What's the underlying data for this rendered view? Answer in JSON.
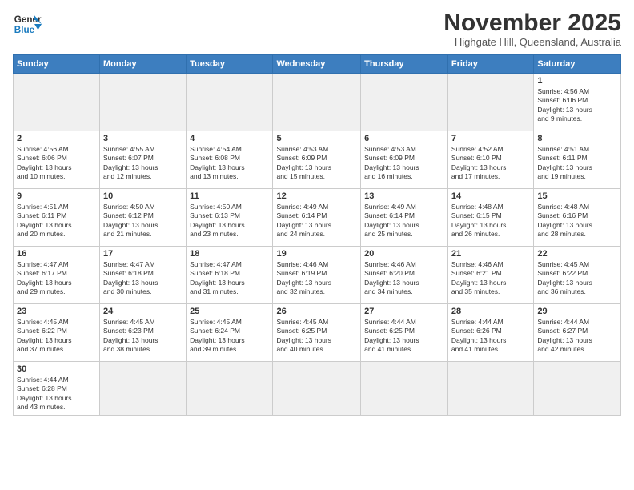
{
  "header": {
    "logo_line1": "General",
    "logo_line2": "Blue",
    "month": "November 2025",
    "location": "Highgate Hill, Queensland, Australia"
  },
  "weekdays": [
    "Sunday",
    "Monday",
    "Tuesday",
    "Wednesday",
    "Thursday",
    "Friday",
    "Saturday"
  ],
  "weeks": [
    [
      {
        "day": "",
        "info": ""
      },
      {
        "day": "",
        "info": ""
      },
      {
        "day": "",
        "info": ""
      },
      {
        "day": "",
        "info": ""
      },
      {
        "day": "",
        "info": ""
      },
      {
        "day": "",
        "info": ""
      },
      {
        "day": "1",
        "info": "Sunrise: 4:56 AM\nSunset: 6:06 PM\nDaylight: 13 hours\nand 9 minutes."
      }
    ],
    [
      {
        "day": "2",
        "info": "Sunrise: 4:56 AM\nSunset: 6:06 PM\nDaylight: 13 hours\nand 10 minutes."
      },
      {
        "day": "3",
        "info": "Sunrise: 4:55 AM\nSunset: 6:07 PM\nDaylight: 13 hours\nand 12 minutes."
      },
      {
        "day": "4",
        "info": "Sunrise: 4:54 AM\nSunset: 6:08 PM\nDaylight: 13 hours\nand 13 minutes."
      },
      {
        "day": "5",
        "info": "Sunrise: 4:53 AM\nSunset: 6:09 PM\nDaylight: 13 hours\nand 15 minutes."
      },
      {
        "day": "6",
        "info": "Sunrise: 4:53 AM\nSunset: 6:09 PM\nDaylight: 13 hours\nand 16 minutes."
      },
      {
        "day": "7",
        "info": "Sunrise: 4:52 AM\nSunset: 6:10 PM\nDaylight: 13 hours\nand 17 minutes."
      },
      {
        "day": "8",
        "info": "Sunrise: 4:51 AM\nSunset: 6:11 PM\nDaylight: 13 hours\nand 19 minutes."
      }
    ],
    [
      {
        "day": "9",
        "info": "Sunrise: 4:51 AM\nSunset: 6:11 PM\nDaylight: 13 hours\nand 20 minutes."
      },
      {
        "day": "10",
        "info": "Sunrise: 4:50 AM\nSunset: 6:12 PM\nDaylight: 13 hours\nand 21 minutes."
      },
      {
        "day": "11",
        "info": "Sunrise: 4:50 AM\nSunset: 6:13 PM\nDaylight: 13 hours\nand 23 minutes."
      },
      {
        "day": "12",
        "info": "Sunrise: 4:49 AM\nSunset: 6:14 PM\nDaylight: 13 hours\nand 24 minutes."
      },
      {
        "day": "13",
        "info": "Sunrise: 4:49 AM\nSunset: 6:14 PM\nDaylight: 13 hours\nand 25 minutes."
      },
      {
        "day": "14",
        "info": "Sunrise: 4:48 AM\nSunset: 6:15 PM\nDaylight: 13 hours\nand 26 minutes."
      },
      {
        "day": "15",
        "info": "Sunrise: 4:48 AM\nSunset: 6:16 PM\nDaylight: 13 hours\nand 28 minutes."
      }
    ],
    [
      {
        "day": "16",
        "info": "Sunrise: 4:47 AM\nSunset: 6:17 PM\nDaylight: 13 hours\nand 29 minutes."
      },
      {
        "day": "17",
        "info": "Sunrise: 4:47 AM\nSunset: 6:18 PM\nDaylight: 13 hours\nand 30 minutes."
      },
      {
        "day": "18",
        "info": "Sunrise: 4:47 AM\nSunset: 6:18 PM\nDaylight: 13 hours\nand 31 minutes."
      },
      {
        "day": "19",
        "info": "Sunrise: 4:46 AM\nSunset: 6:19 PM\nDaylight: 13 hours\nand 32 minutes."
      },
      {
        "day": "20",
        "info": "Sunrise: 4:46 AM\nSunset: 6:20 PM\nDaylight: 13 hours\nand 34 minutes."
      },
      {
        "day": "21",
        "info": "Sunrise: 4:46 AM\nSunset: 6:21 PM\nDaylight: 13 hours\nand 35 minutes."
      },
      {
        "day": "22",
        "info": "Sunrise: 4:45 AM\nSunset: 6:22 PM\nDaylight: 13 hours\nand 36 minutes."
      }
    ],
    [
      {
        "day": "23",
        "info": "Sunrise: 4:45 AM\nSunset: 6:22 PM\nDaylight: 13 hours\nand 37 minutes."
      },
      {
        "day": "24",
        "info": "Sunrise: 4:45 AM\nSunset: 6:23 PM\nDaylight: 13 hours\nand 38 minutes."
      },
      {
        "day": "25",
        "info": "Sunrise: 4:45 AM\nSunset: 6:24 PM\nDaylight: 13 hours\nand 39 minutes."
      },
      {
        "day": "26",
        "info": "Sunrise: 4:45 AM\nSunset: 6:25 PM\nDaylight: 13 hours\nand 40 minutes."
      },
      {
        "day": "27",
        "info": "Sunrise: 4:44 AM\nSunset: 6:25 PM\nDaylight: 13 hours\nand 41 minutes."
      },
      {
        "day": "28",
        "info": "Sunrise: 4:44 AM\nSunset: 6:26 PM\nDaylight: 13 hours\nand 41 minutes."
      },
      {
        "day": "29",
        "info": "Sunrise: 4:44 AM\nSunset: 6:27 PM\nDaylight: 13 hours\nand 42 minutes."
      }
    ],
    [
      {
        "day": "30",
        "info": "Sunrise: 4:44 AM\nSunset: 6:28 PM\nDaylight: 13 hours\nand 43 minutes."
      },
      {
        "day": "",
        "info": ""
      },
      {
        "day": "",
        "info": ""
      },
      {
        "day": "",
        "info": ""
      },
      {
        "day": "",
        "info": ""
      },
      {
        "day": "",
        "info": ""
      },
      {
        "day": "",
        "info": ""
      }
    ]
  ]
}
